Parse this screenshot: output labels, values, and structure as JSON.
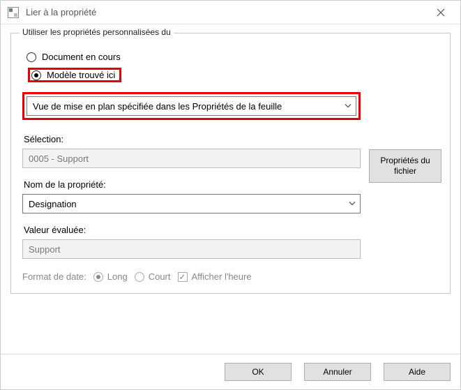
{
  "window": {
    "title": "Lier à la propriété"
  },
  "group": {
    "legend": "Utiliser les propriétés personnalisées du",
    "radio_current": "Document en cours",
    "radio_found": "Modèle trouvé ici",
    "view_dropdown": "Vue de mise en plan spécifiée dans les Propriétés de la feuille",
    "selection_label": "Sélection:",
    "selection_value": "0005 - Support",
    "property_label": "Nom de la propriété:",
    "property_value": "Designation",
    "eval_label": "Valeur évaluée:",
    "eval_value": "Support",
    "date_format_label": "Format de date:",
    "date_long": "Long",
    "date_short": "Court",
    "show_time": "Afficher l'heure",
    "file_props_btn": "Propriétés du fichier"
  },
  "footer": {
    "ok": "OK",
    "cancel": "Annuler",
    "help": "Aide"
  }
}
